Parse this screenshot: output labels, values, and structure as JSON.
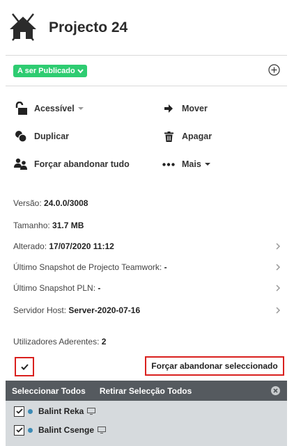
{
  "header": {
    "title": "Projecto 24",
    "icon": "house-icon"
  },
  "status": {
    "label": "A ser Publicado",
    "color": "#2ecc71"
  },
  "actions": {
    "accessible": "Acessível",
    "move": "Mover",
    "duplicate": "Duplicar",
    "delete": "Apagar",
    "force_release_all": "Forçar abandonar tudo",
    "more": "Mais"
  },
  "info": {
    "version_label": "Versão:",
    "version_value": "24.0.0/3008",
    "size_label": "Tamanho:",
    "size_value": "31.7 MB",
    "modified_label": "Alterado:",
    "modified_value": "17/07/2020 11:12",
    "teamwork_label": "Último Snapshot de Projecto Teamwork:",
    "teamwork_value": "-",
    "pln_label": "Último Snapshot PLN:",
    "pln_value": "-",
    "host_label": "Servidor Host:",
    "host_value": "Server-2020-07-16",
    "users_label": "Utilizadores Aderentes:",
    "users_value": "2"
  },
  "force_selected_label": "Forçar abandonar seleccionado",
  "selection_bar": {
    "select_all": "Seleccionar Todos",
    "deselect_all": "Retirar Selecção Todos"
  },
  "users": [
    {
      "name": "Balint Reka",
      "checked": true
    },
    {
      "name": "Balint Csenge",
      "checked": true
    }
  ],
  "colors": {
    "accent_green": "#2ecc71",
    "highlight_red": "#d9201e",
    "bar_bg": "#555a5f",
    "list_bg": "#d6dadd",
    "user_dot": "#3d8bb5"
  }
}
